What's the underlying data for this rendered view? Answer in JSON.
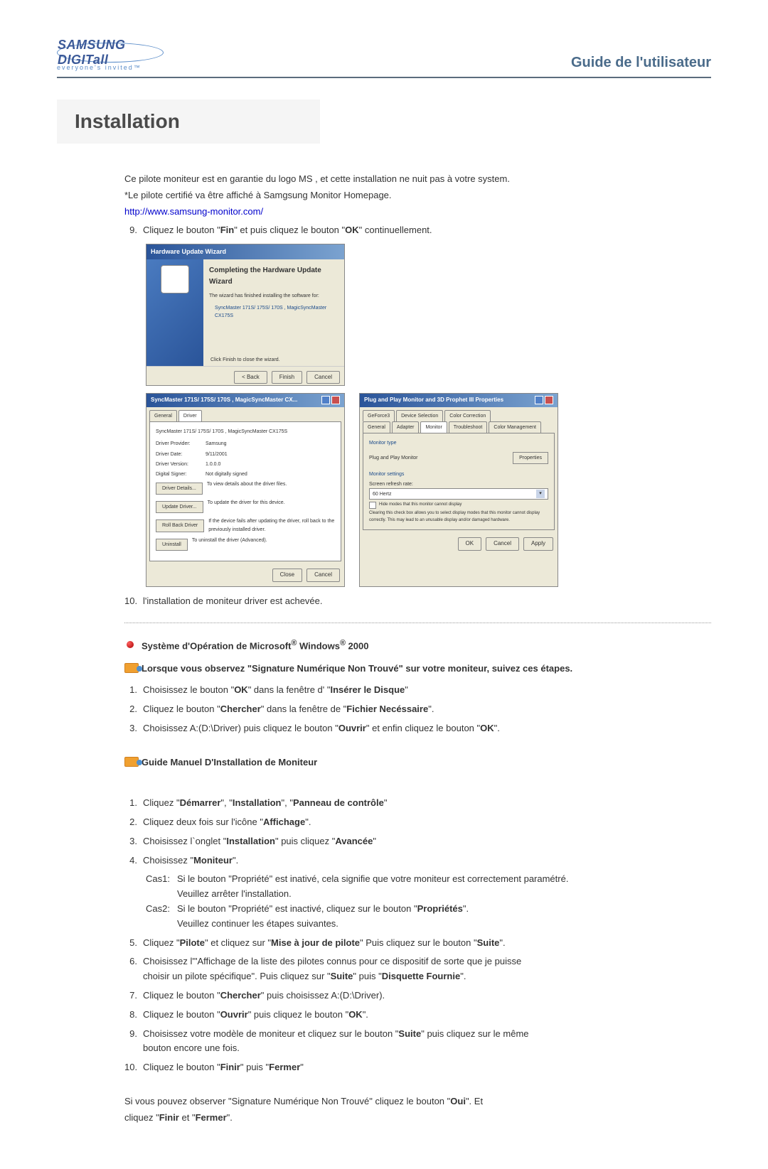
{
  "header": {
    "logo_brand": "SAMSUNG DIGITall",
    "tagline": "everyone's invited™",
    "guide_title": "Guide de l'utilisateur"
  },
  "section_title": "Installation",
  "intro": {
    "line1": "Ce pilote moniteur est en garantie du logo MS , et cette installation ne nuit pas à votre system.",
    "line2": "*Le pilote certifié va être affiché à Samgsung Monitor Homepage.",
    "link": "http://www.samsung-monitor.com/"
  },
  "step9": {
    "num": "9.",
    "prefix": "Cliquez le bouton \"",
    "b1": "Fin",
    "mid": "\" et puis cliquez le bouton \"",
    "b2": "OK",
    "suffix": "\" continuellement."
  },
  "wizard": {
    "title": "Hardware Update Wizard",
    "heading": "Completing the Hardware Update Wizard",
    "sub": "The wizard has finished installing the software for:",
    "device": "SyncMaster 171S/ 175S/ 170S , MagicSyncMaster CX175S",
    "click_text": "Click Finish to close the wizard.",
    "btn_back": "< Back",
    "btn_finish": "Finish",
    "btn_cancel": "Cancel"
  },
  "driver_props": {
    "title": "SyncMaster 171S/ 175S/ 170S , MagicSyncMaster CX...",
    "tab_general": "General",
    "tab_driver": "Driver",
    "device": "SyncMaster 171S/ 175S/ 170S , MagicSyncMaster CX175S",
    "labels": {
      "provider": "Driver Provider:",
      "date": "Driver Date:",
      "version": "Driver Version:",
      "signer": "Digital Signer:"
    },
    "values": {
      "provider": "Samsung",
      "date": "9/11/2001",
      "version": "1.0.0.0",
      "signer": "Not digitally signed"
    },
    "btn_details": "Driver Details...",
    "details_desc": "To view details about the driver files.",
    "btn_update": "Update Driver...",
    "update_desc": "To update the driver for this device.",
    "btn_rollback": "Roll Back Driver",
    "rollback_desc": "If the device fails after updating the driver, roll back to the previously installed driver.",
    "btn_uninstall": "Uninstall",
    "uninstall_desc": "To uninstall the driver (Advanced).",
    "btn_close": "Close",
    "btn_cancel": "Cancel"
  },
  "monitor_props": {
    "title": "Plug and Play Monitor and 3D Prophet III Properties",
    "tabs_top": {
      "geforce": "GeForce3",
      "device_sel": "Device Selection",
      "color_corr": "Color Correction"
    },
    "tabs_bottom": {
      "general": "General",
      "adapter": "Adapter",
      "monitor": "Monitor",
      "troubleshoot": "Troubleshoot",
      "color_mgmt": "Color Management"
    },
    "group_type": "Monitor type",
    "monitor_name": "Plug and Play Monitor",
    "btn_properties": "Properties",
    "group_settings": "Monitor settings",
    "refresh_label": "Screen refresh rate:",
    "refresh_val": "60 Hertz",
    "hide_modes": "Hide modes that this monitor cannot display",
    "hide_desc": "Clearing this check box allows you to select display modes that this monitor cannot display correctly. This may lead to an unusable display and/or damaged hardware.",
    "btn_ok": "OK",
    "btn_cancel": "Cancel",
    "btn_apply": "Apply"
  },
  "step10": {
    "num": "10.",
    "text": "l'installation de moniteur driver est achevée."
  },
  "win2000": {
    "heading_pre": "Système d'Opération de Microsoft",
    "heading_mid": " Windows",
    "heading_suf": " 2000",
    "sig_text": "Lorsque vous observez \"Signature Numérique Non Trouvé\" sur votre moniteur, suivez ces étapes.",
    "steps": [
      {
        "n": "1.",
        "pre": "Choisissez le bouton \"",
        "b1": "OK",
        "mid": "\" dans la fenêtre d' \"",
        "b2": "Insérer le Disque",
        "suf": "\""
      },
      {
        "n": "2.",
        "pre": "Cliquez le bouton \"",
        "b1": "Chercher",
        "mid": "\" dans la fenêtre de \"",
        "b2": "Fichier Necéssaire",
        "suf": "\"."
      },
      {
        "n": "3.",
        "pre": "Choisissez A:(D:\\Driver) puis cliquez le bouton \"",
        "b1": "Ouvrir",
        "mid": "\" et enfin cliquez le bouton \"",
        "b2": "OK",
        "suf": "\"."
      }
    ],
    "manual_heading": "Guide Manuel D'Installation de Moniteur",
    "manual": {
      "s1": {
        "n": "1.",
        "pre": "Cliquez \"",
        "b1": "Démarrer",
        "m1": "\", \"",
        "b2": "Installation",
        "m2": "\", \"",
        "b3": "Panneau de contrôle",
        "suf": "\""
      },
      "s2": {
        "n": "2.",
        "pre": "Cliquez deux fois sur l'icône \"",
        "b1": "Affichage",
        "suf": "\"."
      },
      "s3": {
        "n": "3.",
        "pre": "Choisissez l`onglet \"",
        "b1": "Installation",
        "m1": "\" puis cliquez \"",
        "b2": "Avancée",
        "suf": "\""
      },
      "s4": {
        "n": "4.",
        "pre": "Choisissez \"",
        "b1": "Moniteur",
        "suf": "\"."
      },
      "cas1_label": "Cas1:",
      "cas1_l1": "Si le bouton \"Propriété\" est inativé, cela signifie que votre moniteur est correctement paramétré.",
      "cas1_l2": "Veuillez arrêter l'installation.",
      "cas2_label": "Cas2:",
      "cas2_l1_pre": "Si le bouton \"Propriété\" est inactivé, cliquez sur le bouton \"",
      "cas2_l1_b": "Propriétés",
      "cas2_l1_suf": "\".",
      "cas2_l2": "Veuillez continuer les étapes suivantes.",
      "s5": {
        "n": "5.",
        "pre": "Cliquez \"",
        "b1": "Pilote",
        "m1": "\" et cliquez sur \"",
        "b2": "Mise à jour de pilote",
        "m2": "\" Puis cliquez sur le bouton \"",
        "b3": "Suite",
        "suf": "\"."
      },
      "s6": {
        "n": "6.",
        "l1_pre": "Choisissez l'\"Affichage de la liste des pilotes connus pour ce dispositif de sorte que je puisse",
        "l2_pre": "choisir un pilote spécifique\". Puis cliquez sur \"",
        "b1": "Suite",
        "m1": "\" puis \"",
        "b2": "Disquette Fournie",
        "suf": "\"."
      },
      "s7": {
        "n": "7.",
        "pre": "Cliquez le bouton \"",
        "b1": "Chercher",
        "suf": "\" puis choisissez A:(D:\\Driver)."
      },
      "s8": {
        "n": "8.",
        "pre": "Cliquez le bouton \"",
        "b1": "Ouvrir",
        "m1": "\" puis cliquez le bouton \"",
        "b2": "OK",
        "suf": "\"."
      },
      "s9": {
        "n": "9.",
        "pre": "Choisissez votre modèle de moniteur et cliquez sur le bouton \"",
        "b1": "Suite",
        "m1": "\" puis cliquez sur le même",
        "l2": "bouton encore une fois."
      },
      "s10": {
        "n": "10.",
        "pre": "Cliquez le bouton \"",
        "b1": "Finir",
        "m1": "\" puis \"",
        "b2": "Fermer",
        "suf": "\""
      },
      "footer_l1_pre": "Si vous pouvez observer \"Signature Numérique Non Trouvé\" cliquez le bouton \"",
      "footer_l1_b": "Oui",
      "footer_l1_suf": "\". Et",
      "footer_l2_pre": "cliquez ",
      "footer_l2_q1": "\"",
      "footer_l2_b1": "Finir",
      "footer_l2_m": " et ",
      "footer_l2_q2": "\"",
      "footer_l2_b2": "Fermer",
      "footer_l2_suf": "\"."
    }
  }
}
